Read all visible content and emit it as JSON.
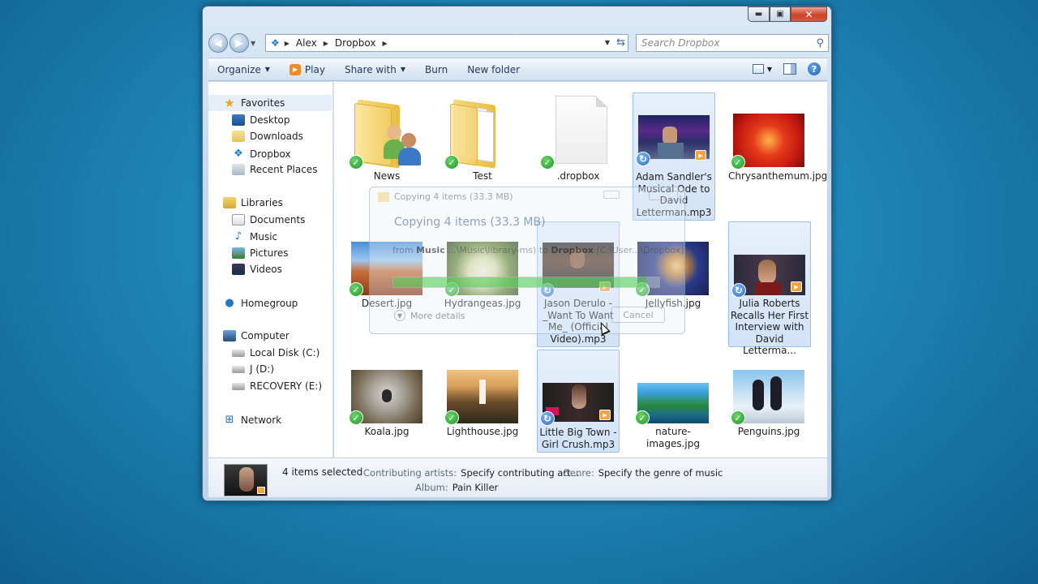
{
  "window": {
    "controls": {
      "minimize": "▬",
      "maximize": "▣",
      "close": "✕"
    }
  },
  "navigation": {
    "back_glyph": "◀",
    "forward_glyph": "▶",
    "breadcrumb": [
      "Alex",
      "Dropbox"
    ],
    "search_placeholder": "Search Dropbox"
  },
  "toolbar": {
    "organize": "Organize",
    "play": "Play",
    "share_with": "Share with",
    "burn": "Burn",
    "new_folder": "New folder"
  },
  "sidebar": {
    "favorites": "Favorites",
    "desktop": "Desktop",
    "downloads": "Downloads",
    "dropbox": "Dropbox",
    "recent_places": "Recent Places",
    "libraries": "Libraries",
    "documents": "Documents",
    "music": "Music",
    "pictures": "Pictures",
    "videos": "Videos",
    "homegroup": "Homegroup",
    "computer": "Computer",
    "local_disk": "Local Disk (C:)",
    "j_drive": "J (D:)",
    "recovery": "RECOVERY (E:)",
    "network": "Network"
  },
  "files": {
    "news": "News",
    "test": "Test",
    "dropbox_file": ".dropbox",
    "adam": "Adam Sandler's Musical Ode to David Letterman.mp3",
    "chrysanthemum": "Chrysanthemum.jpg",
    "desert": "Desert.jpg",
    "hydrangeas": "Hydrangeas.jpg",
    "jason": "Jason Derulo - _Want To Want Me_ (Official Video).mp3",
    "jellyfish": "Jellyfish.jpg",
    "julia": "Julia Roberts Recalls Her First Interview with David Letterma...",
    "koala": "Koala.jpg",
    "lighthouse": "Lighthouse.jpg",
    "little_big_town": "Little Big Town - Girl Crush.mp3",
    "nature": "nature-images.jpg",
    "penguins": "Penguins.jpg"
  },
  "badges": {
    "ok": "✓",
    "sync": "↻",
    "media": "▶"
  },
  "copy_dialog": {
    "title": "Copying 4 items (33.3 MB)",
    "heading": "Copying 4 items (33.3 MB)",
    "from_prefix": "from",
    "from_source": "Music",
    "from_path": "...\\Music\\library-ms)",
    "to_prefix": "to",
    "to_dest": "Dropbox",
    "to_path": "(C:\\User...\\Dropbox)",
    "more_details": "More details",
    "cancel": "Cancel",
    "progress": 0.95
  },
  "details": {
    "selected_count": "4 items selected",
    "contributing_artists_label": "Contributing artists:",
    "contributing_artists_value": "Specify contributing art...",
    "genre_label": "Genre:",
    "genre_value": "Specify the genre of music",
    "album_label": "Album:",
    "album_value": "Pain Killer"
  }
}
